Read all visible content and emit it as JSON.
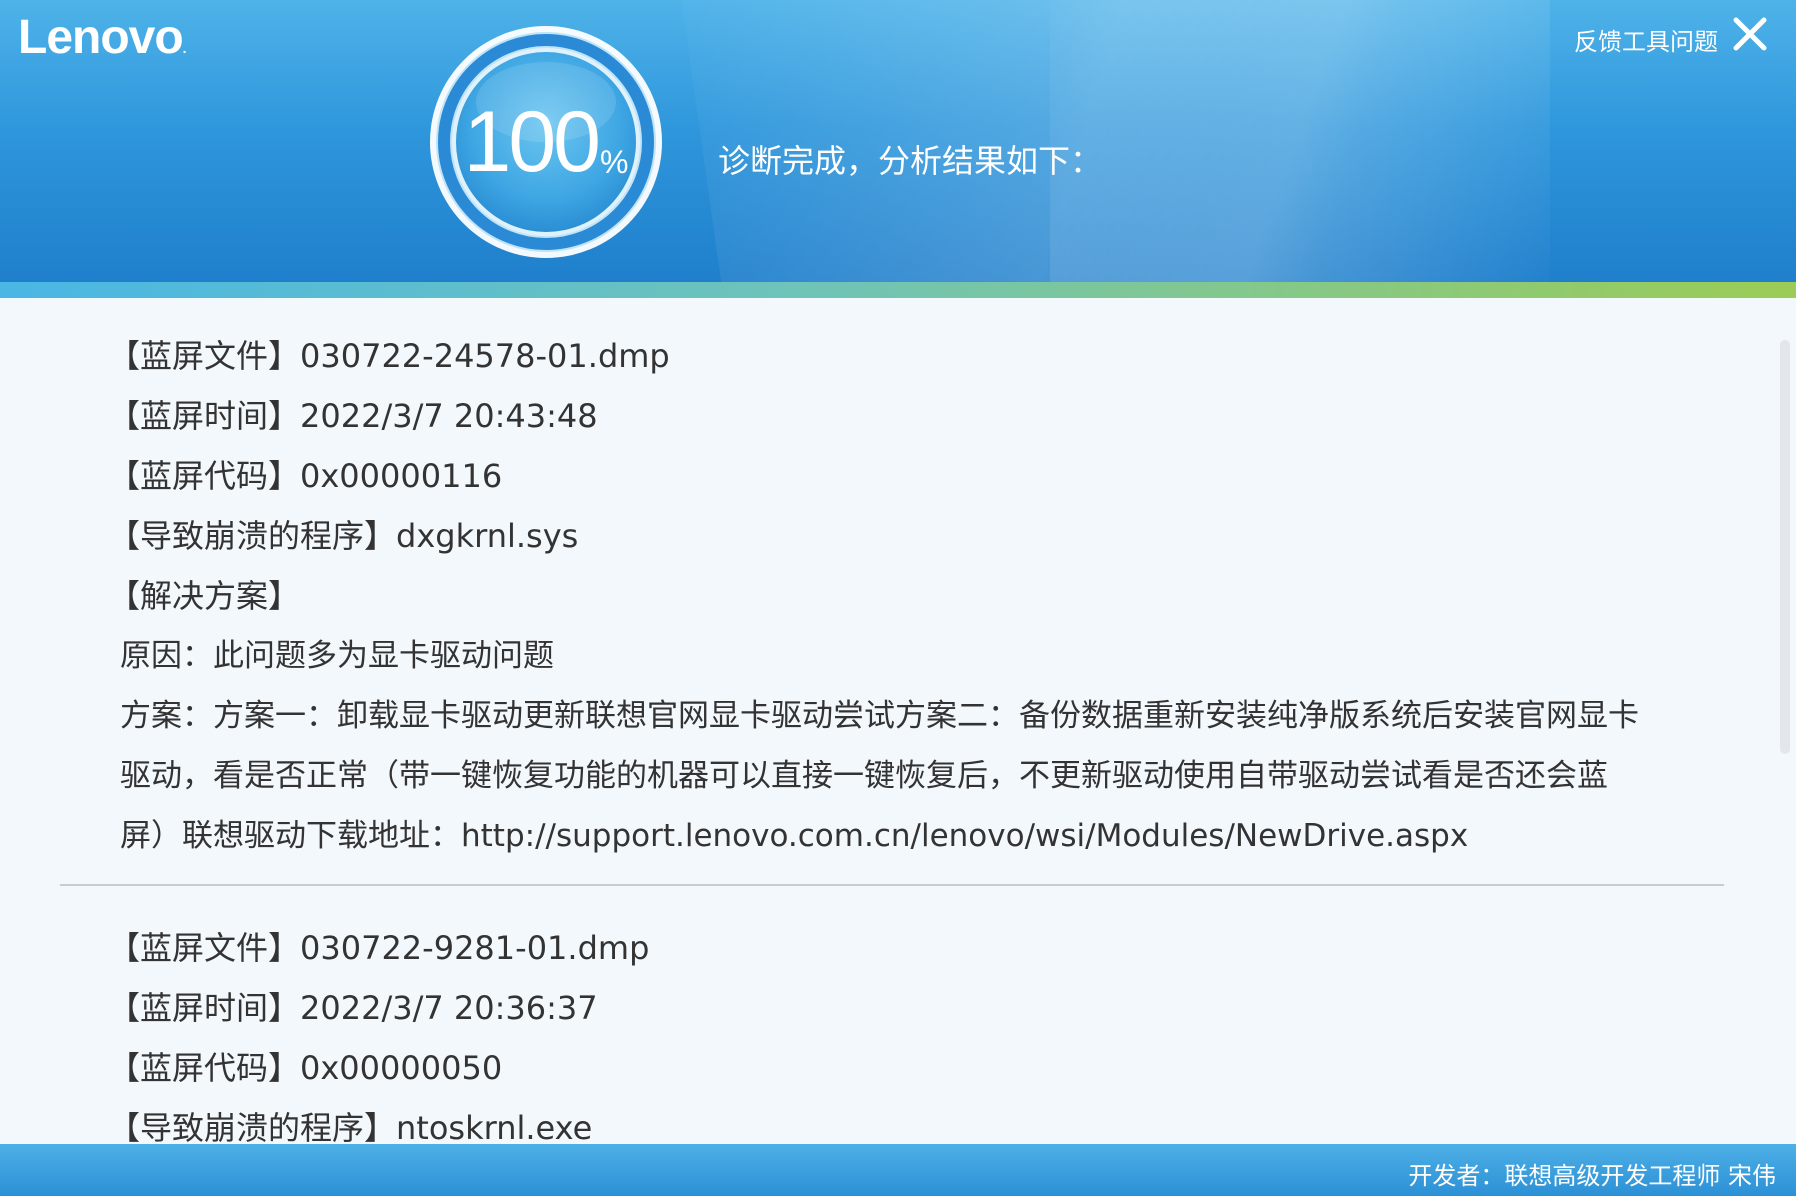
{
  "header": {
    "logo": "Lenovo",
    "logo_mark": ".",
    "feedback_label": "反馈工具问题",
    "close_label": "X",
    "progress_value": "100",
    "progress_unit": "%",
    "progress_fraction": 1.0,
    "status_text": "诊断完成，分析结果如下："
  },
  "records": [
    {
      "file": "【蓝屏文件】030722-24578-01.dmp",
      "time": "【蓝屏时间】2022/3/7 20:43:48",
      "code": "【蓝屏代码】0x00000116",
      "program": "【导致崩溃的程序】dxgkrnl.sys",
      "solution_heading": "【解决方案】",
      "cause": "原因：此问题多为显卡驱动问题",
      "plan": "方案：方案一：卸载显卡驱动更新联想官网显卡驱动尝试方案二：备份数据重新安装纯净版系统后安装官网显卡驱动，看是否正常（带一键恢复功能的机器可以直接一键恢复后，不更新驱动使用自带驱动尝试看是否还会蓝屏）联想驱动下载地址：http://support.lenovo.com.cn/lenovo/wsi/Modules/NewDrive.aspx"
    },
    {
      "file": "【蓝屏文件】030722-9281-01.dmp",
      "time": "【蓝屏时间】2022/3/7 20:36:37",
      "code": "【蓝屏代码】0x00000050",
      "program": "【导致崩溃的程序】ntoskrnl.exe"
    }
  ],
  "footer": {
    "developer": "开发者：联想高级开发工程师 宋伟"
  },
  "colors": {
    "header_top": "#4fb3e9",
    "header_bottom": "#1f7fcc",
    "accent_start": "#49b6e5",
    "accent_end": "#9ccc55",
    "content_bg": "#f3f8fd",
    "text": "#333333"
  }
}
